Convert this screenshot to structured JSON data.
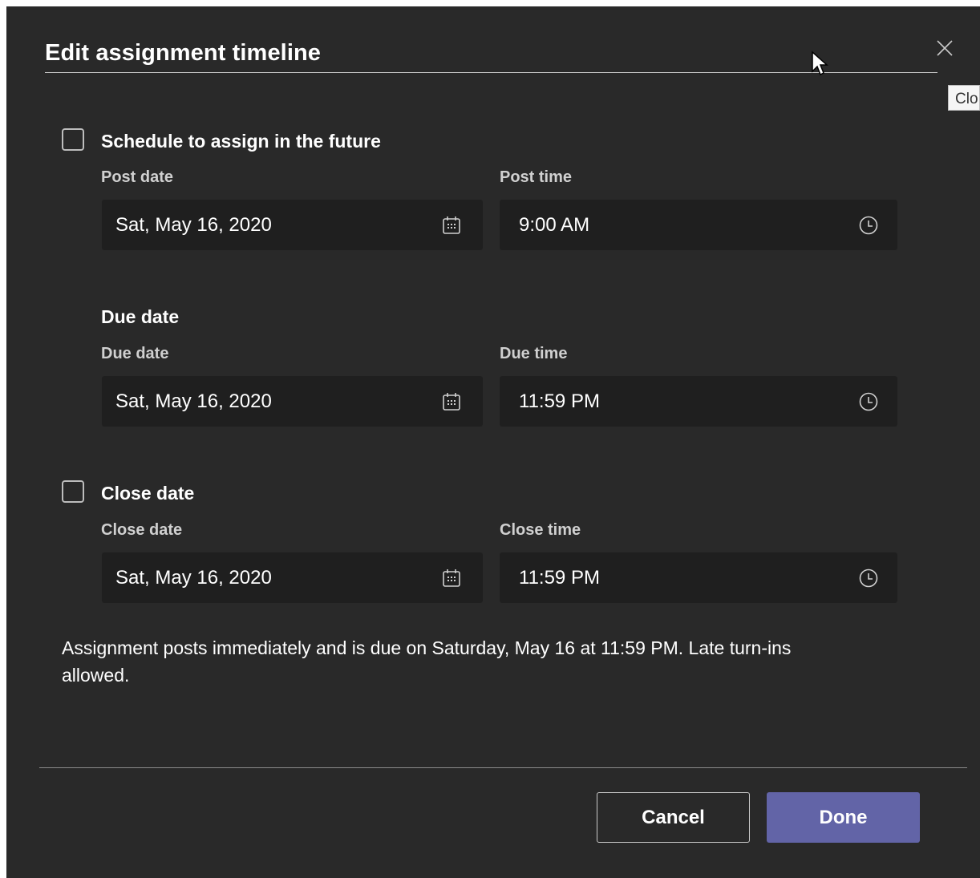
{
  "dialog": {
    "title": "Edit assignment timeline",
    "close_tooltip": "Clo"
  },
  "schedule": {
    "checkbox_label": "Schedule to assign in the future",
    "checked": false,
    "date_label": "Post date",
    "date_value": "Sat, May 16, 2020",
    "time_label": "Post time",
    "time_value": "9:00 AM"
  },
  "due": {
    "heading": "Due date",
    "date_label": "Due date",
    "date_value": "Sat, May 16, 2020",
    "time_label": "Due time",
    "time_value": "11:59 PM"
  },
  "close": {
    "checkbox_label": "Close date",
    "checked": false,
    "date_label": "Close date",
    "date_value": "Sat, May 16, 2020",
    "time_label": "Close time",
    "time_value": "11:59 PM"
  },
  "summary": "Assignment posts immediately and is due on Saturday, May 16 at 11:59 PM. Late turn-ins allowed.",
  "buttons": {
    "cancel": "Cancel",
    "done": "Done"
  },
  "colors": {
    "background": "#292929",
    "field_background": "#1f1f1f",
    "accent": "#6264a7"
  },
  "icons": {
    "close": "close-icon",
    "calendar": "calendar-icon",
    "clock": "clock-icon"
  }
}
